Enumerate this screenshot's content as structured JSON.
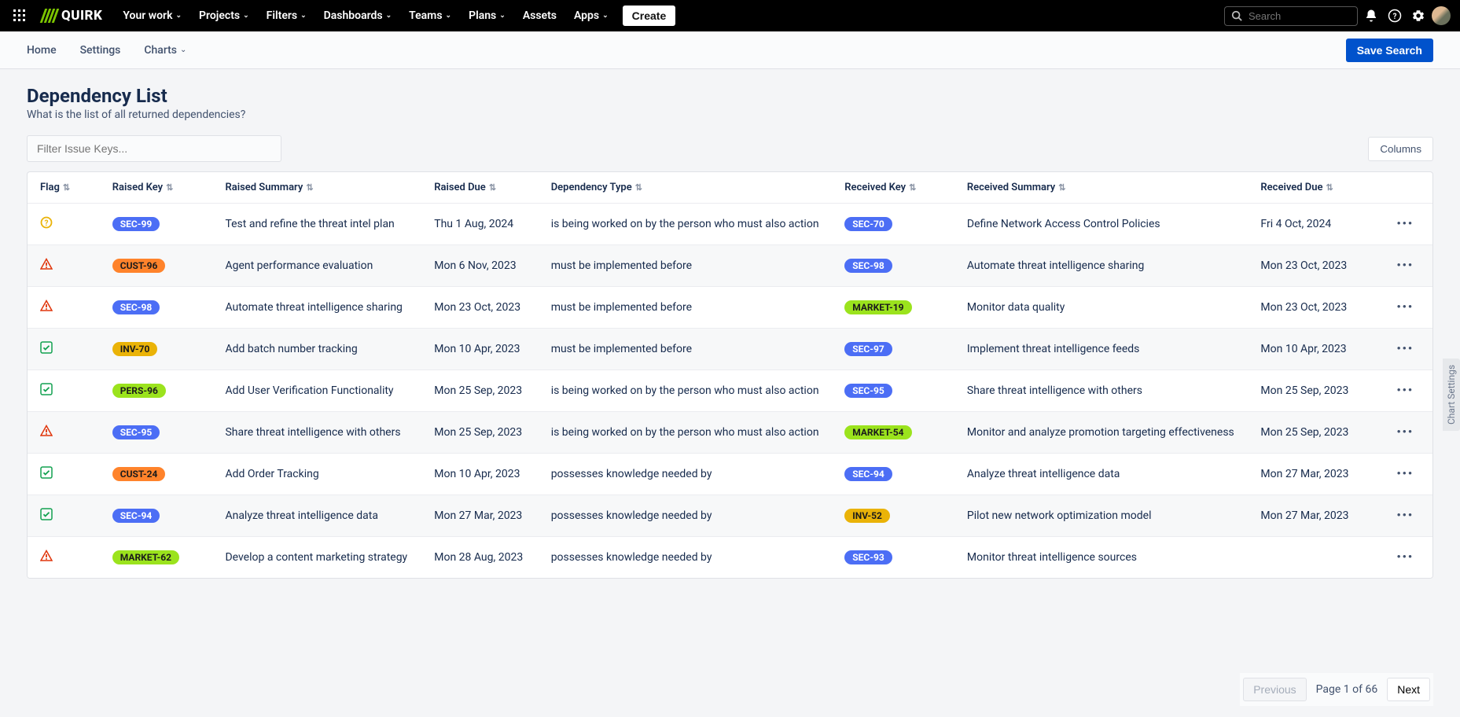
{
  "nav": {
    "brand": "QUIRK",
    "items": [
      "Your work",
      "Projects",
      "Filters",
      "Dashboards",
      "Teams",
      "Plans",
      "Assets",
      "Apps"
    ],
    "hasChevron": [
      true,
      true,
      true,
      true,
      true,
      true,
      false,
      true
    ],
    "create": "Create",
    "searchPlaceholder": "Search"
  },
  "subnav": {
    "home": "Home",
    "settings": "Settings",
    "charts": "Charts",
    "save": "Save Search"
  },
  "page": {
    "title": "Dependency List",
    "subtitle": "What is the list of all returned dependencies?",
    "filterPlaceholder": "Filter Issue Keys...",
    "columnsBtn": "Columns",
    "sideTab": "Chart Settings"
  },
  "headers": {
    "flag": "Flag",
    "rkey": "Raised Key",
    "rsum": "Raised Summary",
    "rdue": "Raised Due",
    "dep": "Dependency Type",
    "rckey": "Received Key",
    "rcsum": "Received Summary",
    "rcdue": "Received Due"
  },
  "rows": [
    {
      "flag": "warn-yellow",
      "rkey": "SEC-99",
      "rkeyColor": "blue",
      "rsum": "Test and refine the threat intel plan",
      "rdue": "Thu 1 Aug, 2024",
      "dep": "is being worked on by the person who must also action",
      "rckey": "SEC-70",
      "rckeyColor": "blue",
      "rcsum": "Define Network Access Control Policies",
      "rcdue": "Fri 4 Oct, 2024"
    },
    {
      "flag": "alert-red",
      "rkey": "CUST-96",
      "rkeyColor": "orange",
      "rsum": "Agent performance evaluation",
      "rdue": "Mon 6 Nov, 2023",
      "dep": "must be implemented before",
      "rckey": "SEC-98",
      "rckeyColor": "blue",
      "rcsum": "Automate threat intelligence sharing",
      "rcdue": "Mon 23 Oct, 2023"
    },
    {
      "flag": "alert-red",
      "rkey": "SEC-98",
      "rkeyColor": "blue",
      "rsum": "Automate threat intelligence sharing",
      "rdue": "Mon 23 Oct, 2023",
      "dep": "must be implemented before",
      "rckey": "MARKET-19",
      "rckeyColor": "lime",
      "rcsum": "Monitor data quality",
      "rcdue": "Mon 23 Oct, 2023"
    },
    {
      "flag": "check-green",
      "rkey": "INV-70",
      "rkeyColor": "yellow",
      "rsum": "Add batch number tracking",
      "rdue": "Mon 10 Apr, 2023",
      "dep": "must be implemented before",
      "rckey": "SEC-97",
      "rckeyColor": "blue",
      "rcsum": "Implement threat intelligence feeds",
      "rcdue": "Mon 10 Apr, 2023"
    },
    {
      "flag": "check-green",
      "rkey": "PERS-96",
      "rkeyColor": "lime",
      "rsum": "Add User Verification Functionality",
      "rdue": "Mon 25 Sep, 2023",
      "dep": "is being worked on by the person who must also action",
      "rckey": "SEC-95",
      "rckeyColor": "blue",
      "rcsum": "Share threat intelligence with others",
      "rcdue": "Mon 25 Sep, 2023"
    },
    {
      "flag": "alert-red",
      "rkey": "SEC-95",
      "rkeyColor": "blue",
      "rsum": "Share threat intelligence with others",
      "rdue": "Mon 25 Sep, 2023",
      "dep": "is being worked on by the person who must also action",
      "rckey": "MARKET-54",
      "rckeyColor": "lime",
      "rcsum": "Monitor and analyze promotion targeting effectiveness",
      "rcdue": "Mon 25 Sep, 2023"
    },
    {
      "flag": "check-green",
      "rkey": "CUST-24",
      "rkeyColor": "orange",
      "rsum": "Add Order Tracking",
      "rdue": "Mon 10 Apr, 2023",
      "dep": "possesses knowledge needed by",
      "rckey": "SEC-94",
      "rckeyColor": "blue",
      "rcsum": "Analyze threat intelligence data",
      "rcdue": "Mon 27 Mar, 2023"
    },
    {
      "flag": "check-green",
      "rkey": "SEC-94",
      "rkeyColor": "blue",
      "rsum": "Analyze threat intelligence data",
      "rdue": "Mon 27 Mar, 2023",
      "dep": "possesses knowledge needed by",
      "rckey": "INV-52",
      "rckeyColor": "yellow",
      "rcsum": "Pilot new network optimization model",
      "rcdue": "Mon 27 Mar, 2023"
    },
    {
      "flag": "alert-red",
      "rkey": "MARKET-62",
      "rkeyColor": "lime",
      "rsum": "Develop a content marketing strategy",
      "rdue": "Mon 28 Aug, 2023",
      "dep": "possesses knowledge needed by",
      "rckey": "SEC-93",
      "rckeyColor": "blue",
      "rcsum": "Monitor threat intelligence sources",
      "rcdue": ""
    }
  ],
  "pager": {
    "prev": "Previous",
    "info": "Page 1 of 66",
    "next": "Next"
  }
}
